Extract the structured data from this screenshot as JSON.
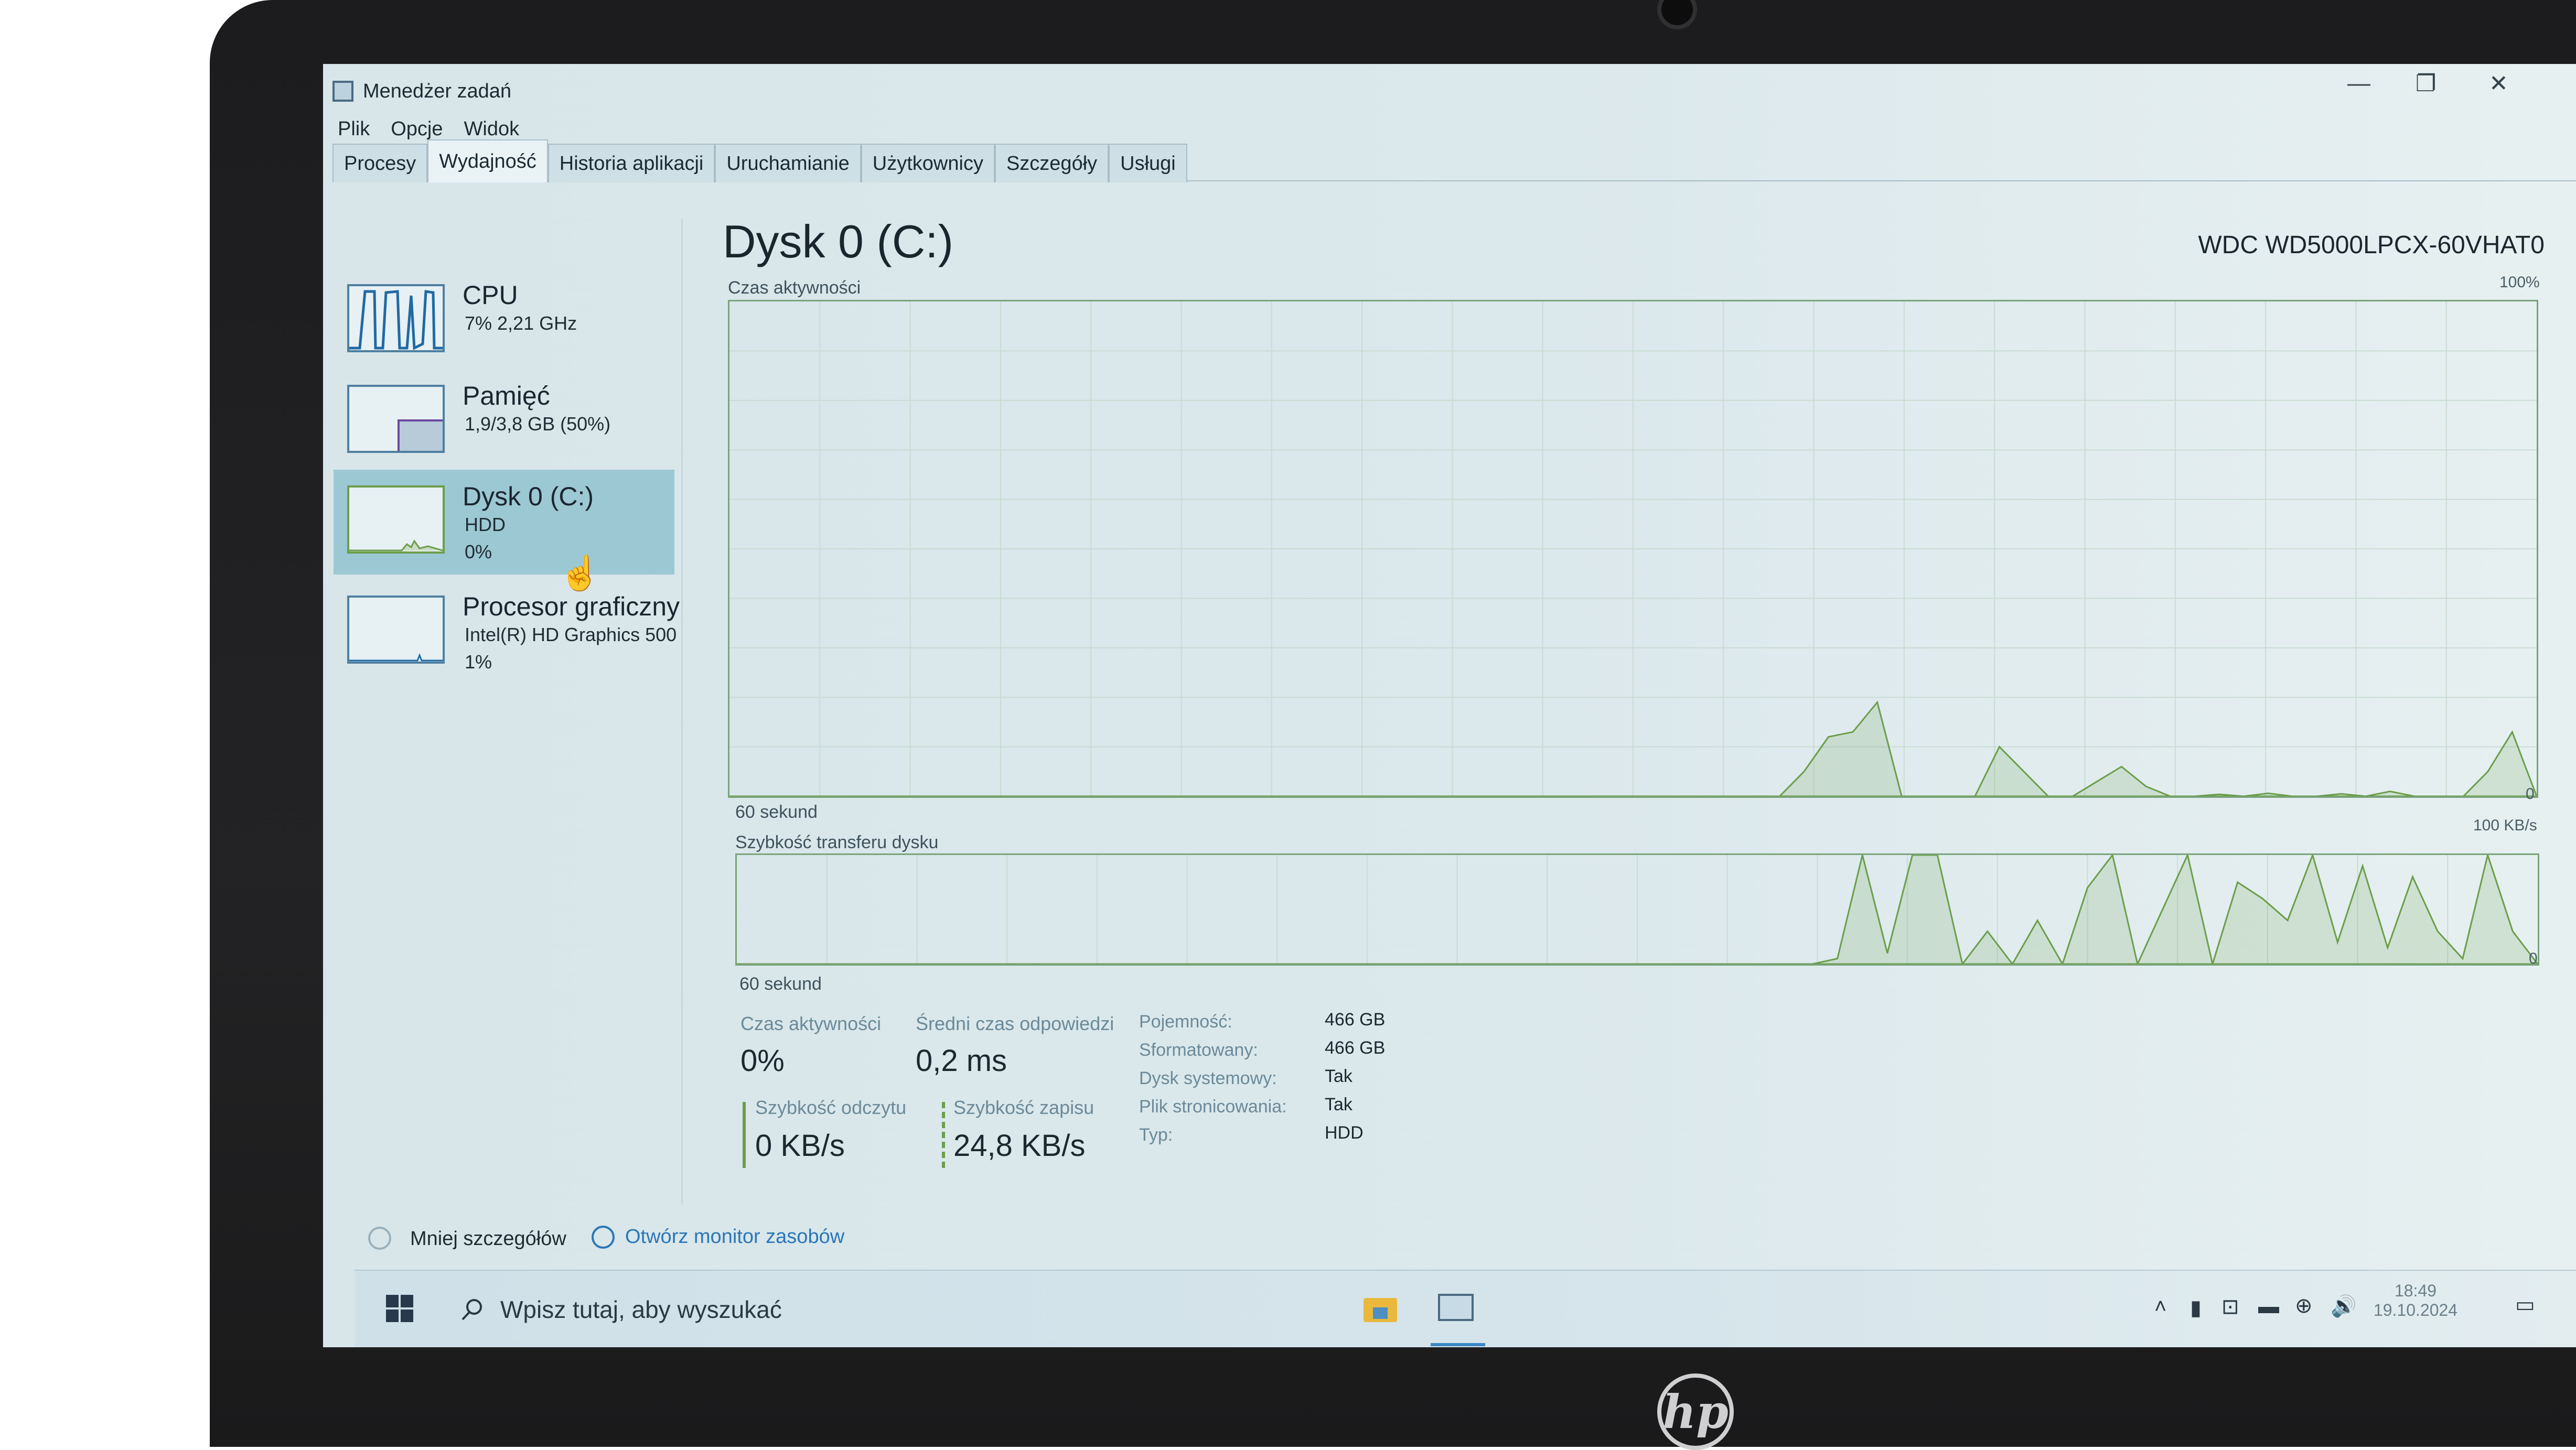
{
  "window": {
    "title": "Menedżer zadań",
    "controls": {
      "minimize": "—",
      "maximize": "❐",
      "close": "✕"
    }
  },
  "menu": [
    "Plik",
    "Opcje",
    "Widok"
  ],
  "tabs": [
    "Procesy",
    "Wydajność",
    "Historia aplikacji",
    "Uruchamianie",
    "Użytkownicy",
    "Szczegóły",
    "Usługi"
  ],
  "active_tab": "Wydajność",
  "perf_list": [
    {
      "name": "CPU",
      "line1": "7% 2,21 GHz",
      "line2": ""
    },
    {
      "name": "Pamięć",
      "line1": "1,9/3,8 GB (50%)",
      "line2": ""
    },
    {
      "name": "Dysk 0 (C:)",
      "line1": "HDD",
      "line2": "0%"
    },
    {
      "name": "Procesor graficzny",
      "line1": "Intel(R) HD Graphics 500",
      "line2": "1%"
    }
  ],
  "selected_item": "Dysk 0 (C:)",
  "disk": {
    "title": "Dysk 0 (C:)",
    "model": "WDC WD5000LPCX-60VHAT0",
    "graph1": {
      "label": "Czas aktywności",
      "max_label": "100%",
      "min_label": "0",
      "time_label": "60 sekund",
      "series": [
        0,
        0,
        0,
        0,
        0,
        0,
        0,
        0,
        0,
        0,
        0,
        0,
        0,
        0,
        0,
        0,
        0,
        0,
        0,
        0,
        0,
        0,
        0,
        0,
        0,
        0,
        0,
        0,
        0,
        0,
        0,
        0,
        0,
        0,
        0,
        0,
        0,
        0,
        0,
        0,
        0,
        0,
        0,
        0,
        5,
        12,
        13,
        19,
        0,
        0,
        0,
        0,
        10,
        5,
        0,
        0,
        3,
        6,
        2,
        0,
        0,
        0.4,
        0,
        0.6,
        0,
        0,
        0.5,
        0,
        1,
        0,
        0,
        0,
        5,
        13,
        0
      ]
    },
    "graph2": {
      "label": "Szybkość transferu dysku",
      "max_label": "100 KB/s",
      "min_label": "0",
      "time_label": "60 sekund",
      "series": [
        0,
        0,
        0,
        0,
        0,
        0,
        0,
        0,
        0,
        0,
        0,
        0,
        0,
        0,
        0,
        0,
        0,
        0,
        0,
        0,
        0,
        0,
        0,
        0,
        0,
        0,
        0,
        0,
        0,
        0,
        0,
        0,
        0,
        0,
        0,
        0,
        0,
        0,
        0,
        0,
        0,
        0,
        0,
        0,
        5,
        100,
        10,
        100,
        100,
        0,
        30,
        0,
        40,
        0,
        70,
        100,
        0,
        50,
        100,
        0,
        75,
        60,
        40,
        100,
        20,
        90,
        15,
        80,
        30,
        5,
        100,
        30,
        0
      ]
    },
    "stats": {
      "active_time_label": "Czas aktywności",
      "active_time_value": "0%",
      "avg_response_label": "Średni czas odpowiedzi",
      "avg_response_value": "0,2 ms",
      "read_speed_label": "Szybkość odczytu",
      "read_speed_value": "0 KB/s",
      "write_speed_label": "Szybkość zapisu",
      "write_speed_value": "24,8 KB/s"
    },
    "properties": [
      {
        "key": "Pojemność:",
        "value": "466 GB"
      },
      {
        "key": "Sformatowany:",
        "value": "466 GB"
      },
      {
        "key": "Dysk systemowy:",
        "value": "Tak"
      },
      {
        "key": "Plik stronicowania:",
        "value": "Tak"
      },
      {
        "key": "Typ:",
        "value": "HDD"
      }
    ]
  },
  "footer": {
    "fewer_details": "Mniej szczegółów",
    "resource_monitor": "Otwórz monitor zasobów"
  },
  "taskbar": {
    "search_placeholder": "Wpisz tutaj, aby wyszukać",
    "time": "18:49",
    "date": "19.10.2024"
  },
  "colors": {
    "accent_disk": "#6b9e4a",
    "cpu_line": "#1f6aa5",
    "link": "#2a76b7",
    "selected_bg": "#9cc8d3"
  },
  "brand": "hp"
}
